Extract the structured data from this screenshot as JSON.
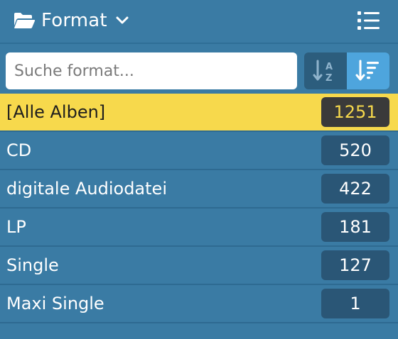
{
  "header": {
    "title": "Format",
    "folder_icon": "folder-open-icon",
    "dropdown_icon": "chevron-down-icon",
    "menu_icon": "list-icon"
  },
  "search": {
    "placeholder": "Suche format...",
    "value": ""
  },
  "sort": {
    "options": [
      {
        "name": "sort-alphabetical",
        "icon": "sort-alpha-icon",
        "active": false
      },
      {
        "name": "sort-by-count",
        "icon": "sort-count-icon",
        "active": true
      }
    ]
  },
  "items": [
    {
      "label": "[Alle Alben]",
      "count": "1251",
      "selected": true
    },
    {
      "label": "CD",
      "count": "520",
      "selected": false
    },
    {
      "label": "digitale Audiodatei",
      "count": "422",
      "selected": false
    },
    {
      "label": "LP",
      "count": "181",
      "selected": false
    },
    {
      "label": "Single",
      "count": "127",
      "selected": false
    },
    {
      "label": "Maxi Single",
      "count": "1",
      "selected": false
    }
  ],
  "colors": {
    "background": "#3a7ba4",
    "selected": "#f7d94c",
    "badge": "#2a5676",
    "active_sort": "#4ea5dd"
  }
}
